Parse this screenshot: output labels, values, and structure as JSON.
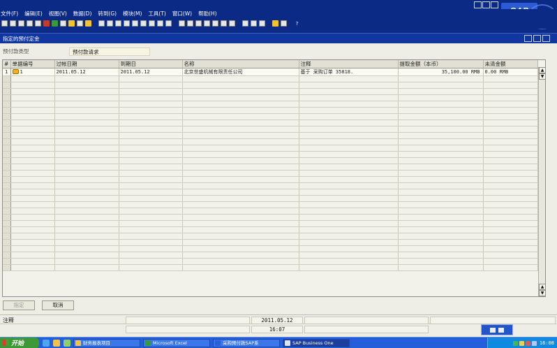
{
  "menu": [
    "文件(F)",
    "编辑(E)",
    "视图(V)",
    "数据(D)",
    "转到(G)",
    "模块(M)",
    "工具(T)",
    "窗口(W)",
    "帮助(H)"
  ],
  "brand": "SAP",
  "window": {
    "title": "指定的预付定金"
  },
  "form": {
    "type_label": "预付款类型",
    "type_value": "预付款请求"
  },
  "grid": {
    "columns": [
      "#",
      "单据编号",
      "过帐日期",
      "到期日",
      "名称",
      "注释",
      "提取金额（本币）",
      "未清金额"
    ],
    "rows": [
      {
        "no": "1",
        "doc": "1",
        "posting": "2011.05.12",
        "due": "2011.05.12",
        "name": "北京世盛机械有限责任公司",
        "remark": "基于 采购订单 35818.",
        "amount": "35,100.00 RMB",
        "open": "0.00 RMB"
      }
    ]
  },
  "buttons": {
    "ok": "指定",
    "cancel": "取消"
  },
  "status": {
    "note": "注释",
    "date": "2011.05.12",
    "time": "16:07"
  },
  "taskbar": {
    "start": "开始",
    "tasks": [
      "财务报表项目",
      "Microsoft Excel",
      "采购预付款SAP系",
      "SAP Business One"
    ],
    "clock": "16:08"
  },
  "colors": {
    "titlebar": "#0b2a86",
    "window_title": "#1236a0",
    "taskbar": "#245edb",
    "start": "#3c9a36"
  }
}
